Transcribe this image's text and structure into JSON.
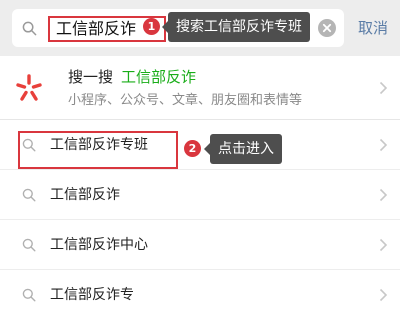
{
  "search": {
    "query": "工信部反诈",
    "cancel_label": "取消"
  },
  "annotations": [
    {
      "number": "1",
      "text": "搜索工信部反诈专班"
    },
    {
      "number": "2",
      "text": "点击进入"
    }
  ],
  "sousou": {
    "title": "搜一搜",
    "keyword": "工信部反诈",
    "subtitle": "小程序、公众号、文章、朋友圈和表情等"
  },
  "suggestions": [
    "工信部反诈专班",
    "工信部反诈",
    "工信部反诈中心",
    "工信部反诈专"
  ],
  "colors": {
    "annotation_red": "#d9363e",
    "keyword_green": "#1aad19",
    "cancel_blue": "#5a7ca6",
    "tooltip_gray": "#4e4e4e"
  }
}
